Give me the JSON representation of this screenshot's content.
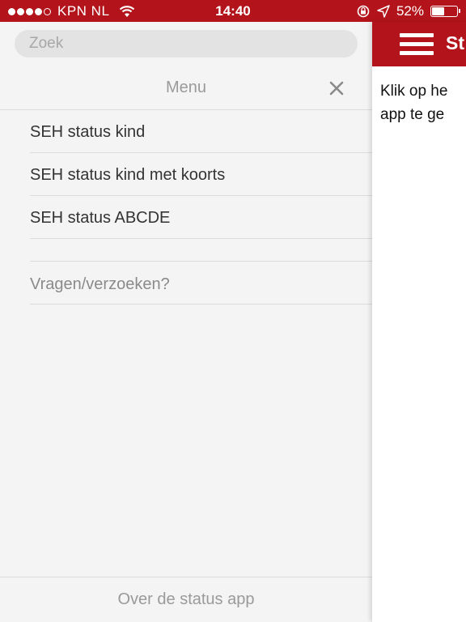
{
  "status_bar": {
    "carrier": "KPN NL",
    "time": "14:40",
    "battery": "52%",
    "battery_level": 0.52
  },
  "menu": {
    "search_placeholder": "Zoek",
    "title": "Menu",
    "items": [
      {
        "label": "SEH status kind"
      },
      {
        "label": "SEH status kind met koorts"
      },
      {
        "label": "SEH status ABCDE"
      },
      {
        "label": ""
      },
      {
        "label": "Vragen/verzoeken?"
      }
    ],
    "footer": "Over de status app"
  },
  "main": {
    "title": "St",
    "text_line1": "Klik op he",
    "text_line2": "app te ge"
  },
  "colors": {
    "brand_red": "#b3141b",
    "menu_bg": "#f4f4f4"
  },
  "icons": {
    "close": "close-icon",
    "menu": "hamburger-icon",
    "wifi": "wifi-icon",
    "location": "location-arrow-icon",
    "orientation_lock": "orientation-lock-icon",
    "battery": "battery-icon"
  }
}
